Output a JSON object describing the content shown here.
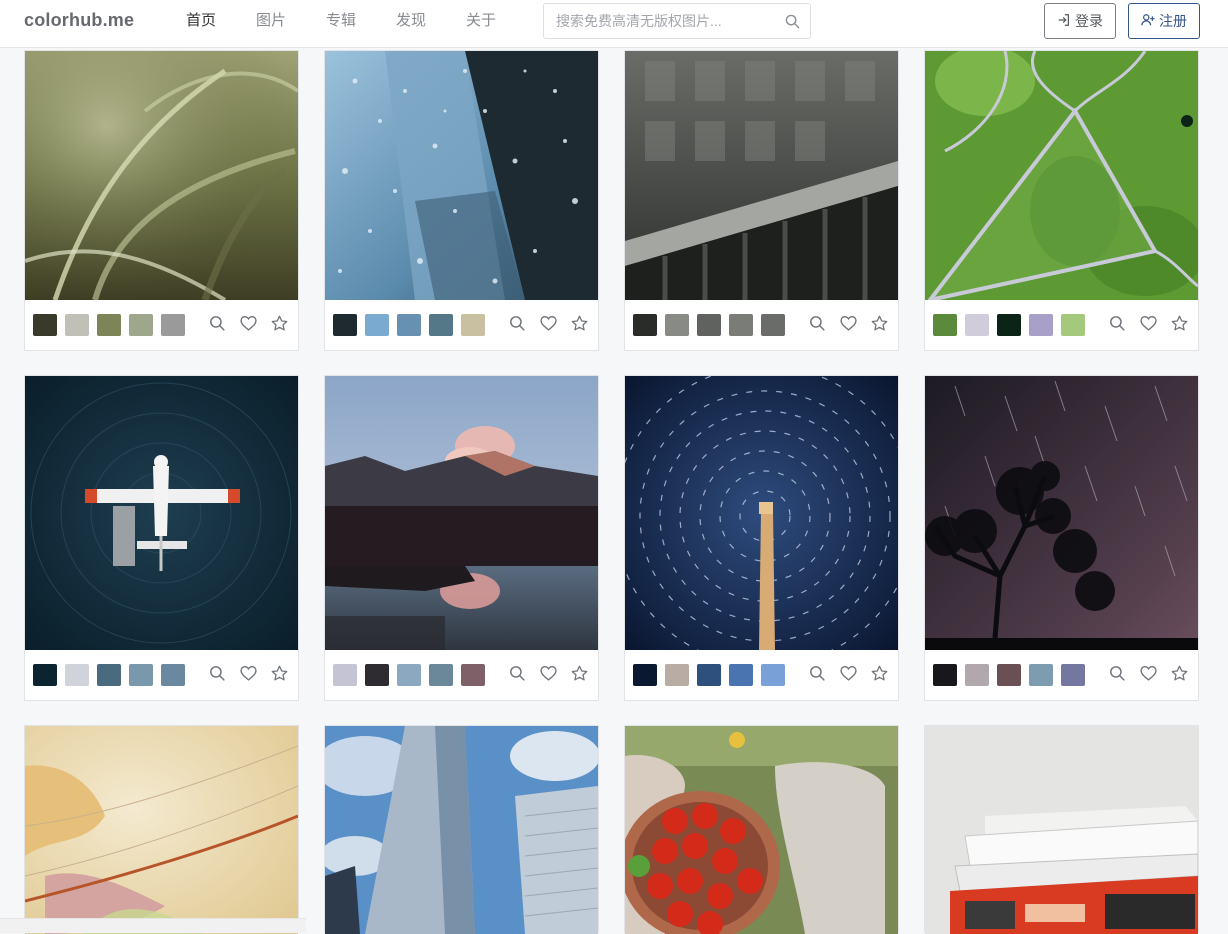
{
  "header": {
    "logo": "colorhub.me",
    "nav": [
      "首页",
      "图片",
      "专辑",
      "发现",
      "关于"
    ],
    "active_nav": "首页",
    "search_placeholder": "搜索免费高清无版权图片...",
    "search_value": "",
    "login_label": "登录",
    "register_label": "注册"
  },
  "icons": {
    "search": "search-icon",
    "login": "sign-in-icon",
    "register": "user-plus-icon",
    "zoom": "magnifier-icon",
    "like": "heart-icon",
    "favorite": "star-icon"
  },
  "cards": [
    {
      "photo": "grass blades with water droplets",
      "palette": [
        "#3a3a2a",
        "#c0c0b8",
        "#7c8458",
        "#9ea68c",
        "#9a9a9a"
      ]
    },
    {
      "photo": "rain drops on glass with blue building",
      "palette": [
        "#1e2a30",
        "#7aaad0",
        "#6890b0",
        "#547888",
        "#c8c0a0"
      ]
    },
    {
      "photo": "dark balcony railing",
      "palette": [
        "#2a2c2a",
        "#888a86",
        "#606260",
        "#7a7c78",
        "#6a6c6a"
      ]
    },
    {
      "photo": "aerial green field with road",
      "palette": [
        "#5c8a3c",
        "#d0ccdc",
        "#0c2418",
        "#a8a0c8",
        "#a4c87c"
      ]
    },
    {
      "photo": "seaplane on dark water",
      "palette": [
        "#0c2430",
        "#d0d4da",
        "#4a6a80",
        "#7a98ac",
        "#6a88a0"
      ]
    },
    {
      "photo": "mountain reflected in lake",
      "palette": [
        "#c4c4d4",
        "#2e2c30",
        "#8ca8c0",
        "#6a8898",
        "#806068"
      ]
    },
    {
      "photo": "star trails above tower",
      "palette": [
        "#0a1830",
        "#b8aca4",
        "#2e507c",
        "#4a74b0",
        "#7aa0d8"
      ]
    },
    {
      "photo": "tree silhouette under meteor sky",
      "palette": [
        "#18181c",
        "#b0a8ac",
        "#6a5054",
        "#7e9cb0",
        "#7478a0"
      ]
    },
    {
      "photo": "globe close-up",
      "palette": []
    },
    {
      "photo": "skyscrapers and blue sky",
      "palette": []
    },
    {
      "photo": "bowl of cherry tomatoes",
      "palette": []
    },
    {
      "photo": "stack of books",
      "palette": []
    }
  ]
}
